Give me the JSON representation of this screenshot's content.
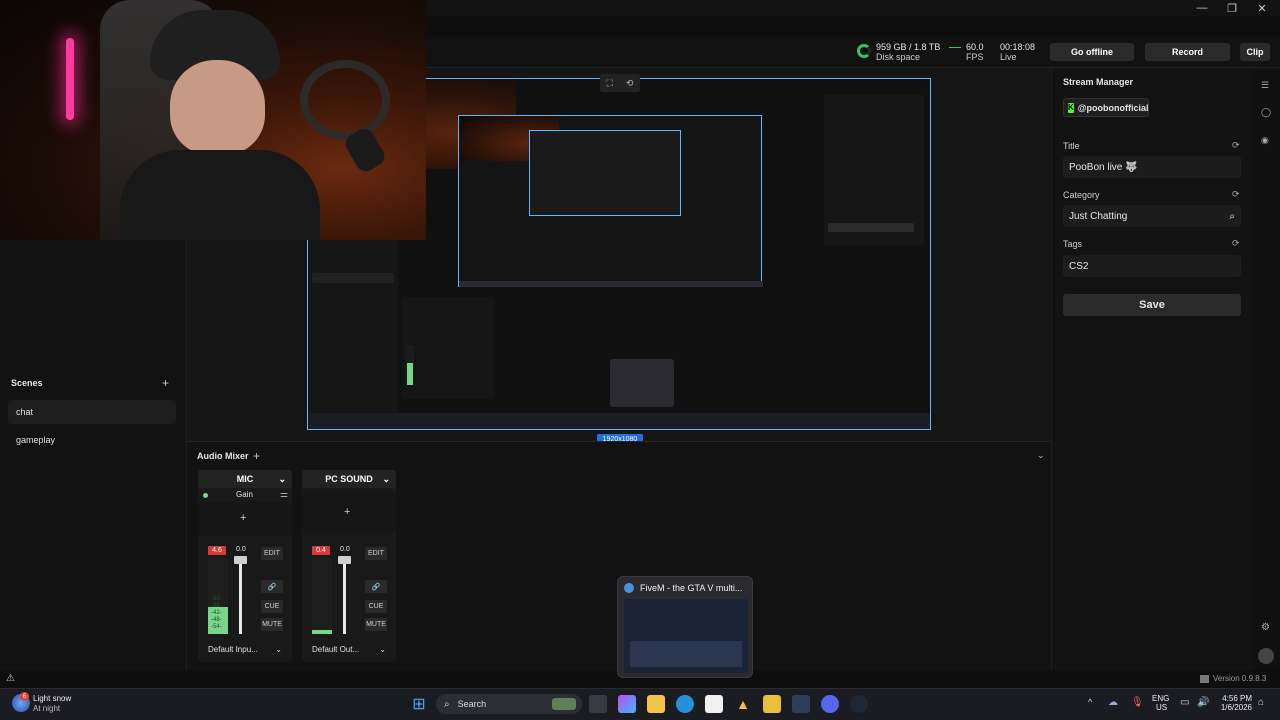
{
  "window": {
    "minimize": "—",
    "restore": "❐",
    "close": "✕"
  },
  "topbar": {
    "disk_value": "959 GB / 1.8 TB",
    "disk_label": "Disk space",
    "fps_value": "60.0",
    "fps_label": "FPS",
    "time_value": "00:18:08",
    "time_label": "Live",
    "go_offline": "Go offline",
    "record": "Record",
    "clip": "Clip"
  },
  "scenes": {
    "title": "Scenes",
    "add": "+",
    "items": [
      {
        "label": "chat"
      },
      {
        "label": "gameplay"
      }
    ]
  },
  "preview": {
    "resolution": "1920x1080"
  },
  "audio_mixer": {
    "title": "Audio Mixer",
    "add": "+",
    "channels": [
      {
        "name": "MIC",
        "gain": "Gain",
        "add": "+",
        "peak": "4.6",
        "vol": "0.0",
        "edit": "EDIT",
        "cue": "CUE",
        "mute": "MUTE",
        "device": "Default Inpu...",
        "meter_level": 0.35,
        "scale": [
          "-30-",
          "-36-",
          "-42-",
          "-48-",
          "-54-"
        ]
      },
      {
        "name": "PC SOUND",
        "add": "+",
        "peak": "0.4",
        "vol": "0.0",
        "edit": "EDIT",
        "cue": "CUE",
        "mute": "MUTE",
        "device": "Default Out...",
        "meter_level": 0.05
      }
    ]
  },
  "stream_manager": {
    "title": "Stream Manager",
    "account": "@poobonofficial",
    "title_label": "Title",
    "title_value": "PooBon live 🐺",
    "category_label": "Category",
    "category_value": "Just Chatting",
    "tags_label": "Tags",
    "tags_value": "CS2",
    "save": "Save"
  },
  "version": "Version 0.9.8.3",
  "popup": {
    "title": "FiveM - the GTA V multi..."
  },
  "taskbar": {
    "weather_temp": "Light snow",
    "weather_sub": "At night",
    "search": "Search",
    "lang1": "ENG",
    "lang2": "US",
    "time": "4:56 PM",
    "date": "1/6/2026"
  },
  "colors": {
    "accent_green": "#31c46b",
    "kick_green": "#53fc18",
    "meter_red": "#d43b3b",
    "selection_blue": "#5fb7ff"
  }
}
